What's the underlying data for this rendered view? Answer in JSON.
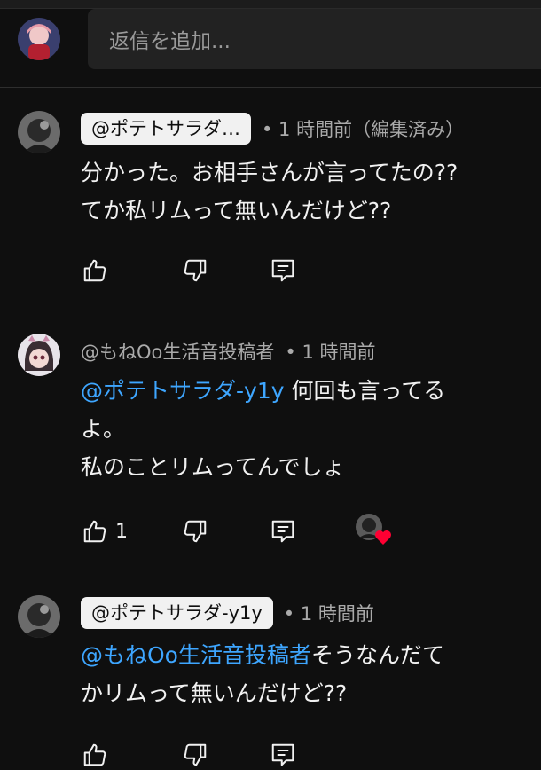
{
  "reply": {
    "placeholder": "返信を追加..."
  },
  "comments": [
    {
      "author": "@ポテトサラダ…",
      "time": "• 1 時間前（編集済み）",
      "text_lines": [
        "分かった。お相手さんが言ってたの??",
        "てか私リムって無いんだけど??"
      ],
      "likes": ""
    },
    {
      "author": "@もねOo生活音投稿者",
      "time": "• 1 時間前",
      "mention": "@ポテトサラダ-y1y",
      "text_first_rest": " 何回も言ってる",
      "text_lines_rest": [
        "よ。",
        "私のことリムってんでしょ"
      ],
      "likes": "1",
      "creator_heart": true
    },
    {
      "author": "@ポテトサラダ-y1y",
      "time": "• 1 時間前",
      "mention": "@もねOo生活音投稿者",
      "text_first_rest": "そうなんだて",
      "text_lines_rest": [
        "かリムって無いんだけど??"
      ],
      "likes": ""
    }
  ],
  "colors": {
    "background": "#0f0f0f",
    "mention": "#3ea6ff",
    "chip": "#f1f1f1",
    "heart": "#ff0033"
  },
  "icons": [
    "like-icon",
    "dislike-icon",
    "reply-icon",
    "heart-icon"
  ]
}
